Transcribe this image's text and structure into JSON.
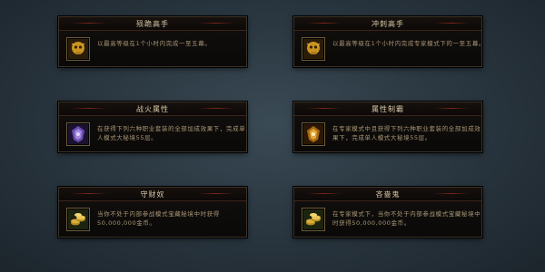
{
  "achievements": [
    {
      "title": "殒跪高手",
      "desc_lines": [
        "以最高等级在1个小时内完成一至五幕。"
      ],
      "icon": "gold-skull-icon"
    },
    {
      "title": "冲刺高手",
      "desc_lines": [
        "以最高等级在1个小时内完成专家模式下的一至五幕。"
      ],
      "icon": "gold-skull-icon"
    },
    {
      "title": "战火属性",
      "desc_lines": [
        "在获得下列六种职业套装的全部加成效果下，完成单",
        "人模式大秘境55层。"
      ],
      "icon": "violet-crest-icon"
    },
    {
      "title": "属性制霸",
      "desc_lines": [
        "在专家模式中且获得下列六种职业套装的全部加成效",
        "果下，完成单人模式大秘境55层。"
      ],
      "icon": "gold-crest-icon"
    },
    {
      "title": "守财奴",
      "desc_lines": [
        "当你不处于内部参战模式宝藏秘境中时获得",
        "50,000,000金币。"
      ],
      "icon": "gold-coins-icon"
    },
    {
      "title": "吝啬鬼",
      "desc_lines": [
        "在专家模式下，当你不处于内部参战模式宝藏秘境中",
        "时获得50,000,000金币。"
      ],
      "icon": "gold-coins-icon"
    }
  ]
}
